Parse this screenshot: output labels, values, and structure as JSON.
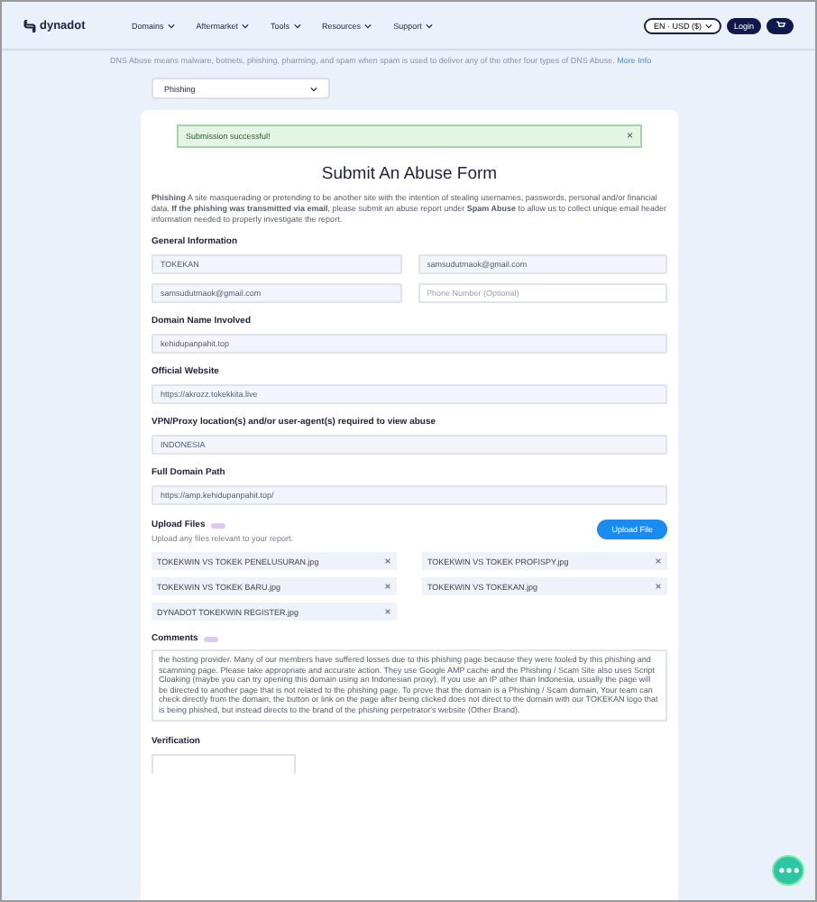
{
  "header": {
    "brand": "dynadot",
    "nav": [
      {
        "label": "Domains"
      },
      {
        "label": "Aftermarket"
      },
      {
        "label": "Tools"
      },
      {
        "label": "Resources"
      },
      {
        "label": "Support"
      }
    ],
    "language": "EN · USD ($)",
    "login": "Login"
  },
  "notice": {
    "text": "DNS Abuse means malware, botnets, phishing, pharming, and spam when spam is used to deliver any of the other four types of DNS Abuse.",
    "link": "More Info"
  },
  "abuse_type": {
    "value": "Phishing"
  },
  "alert": {
    "text": "Submission successful!",
    "close": "×"
  },
  "title": "Submit An Abuse Form",
  "description": "**Phishing** A site masquerading or pretending to be another site with the intention of stealing usernames, passwords, personal and/or financial data. **If the phishing was transmitted via email**, please submit an abuse report under **Spam Abuse** to allow us to collect unique email header information needed to properly investigate the report.",
  "general_information": {
    "heading": "General Information",
    "fields": [
      {
        "value": "TOKEKAN"
      },
      {
        "value": "samsudutmaok@gmail.com"
      },
      {
        "value": "samsudutmaok@gmail.com"
      },
      {
        "placeholder": "Phone Number (Optional)"
      }
    ]
  },
  "sections": [
    {
      "heading": "Domain Name Involved",
      "value": "kehidupanpahit.top"
    },
    {
      "heading": "Official Website",
      "value": "https://akrozz.tokekkita.live"
    },
    {
      "heading": "VPN/Proxy location(s) and/or user-agent(s) required to view abuse",
      "value": "INDONESIA"
    },
    {
      "heading": "Full Domain Path",
      "value": "https://amp.kehidupanpahit.top/"
    }
  ],
  "upload": {
    "heading": "Upload Files",
    "hint": "Upload any files relevant to your report.",
    "button": "Upload File",
    "files": [
      {
        "name": "TOKEKWIN VS TOKEK PENELUSURAN.jpg"
      },
      {
        "name": "TOKEKWIN VS TOKEK PROFISPY.jpg"
      },
      {
        "name": "TOKEKWIN VS TOKEK BARU.jpg"
      },
      {
        "name": "TOKEKWIN VS TOKEKAN.jpg"
      },
      {
        "name": "DYNADOT TOKEKWIN REGISTER.jpg"
      }
    ]
  },
  "comments": {
    "heading": "Comments",
    "value": "the hosting provider. Many of our members have suffered losses due to this phishing page because they were fooled by this phishing and scamming page. Please take appropriate and accurate action. They use Google AMP cache and the Phishing / Scam Site also uses Script Cloaking (maybe you can try opening this domain using an Indonesian proxy). If you use an IP other than Indonesia, usually the page will be directed to another page that is not related to the phishing page. To prove that the domain is a Phishing / Scam domain, Your team can check directly from the domain, the button or link on the page after being clicked does not direct to the domain with our TOKEKAN logo that is being phished, but instead directs to the brand of the phishing perpetrator's website (Other Brand)."
  },
  "verification": {
    "heading": "Verification"
  }
}
